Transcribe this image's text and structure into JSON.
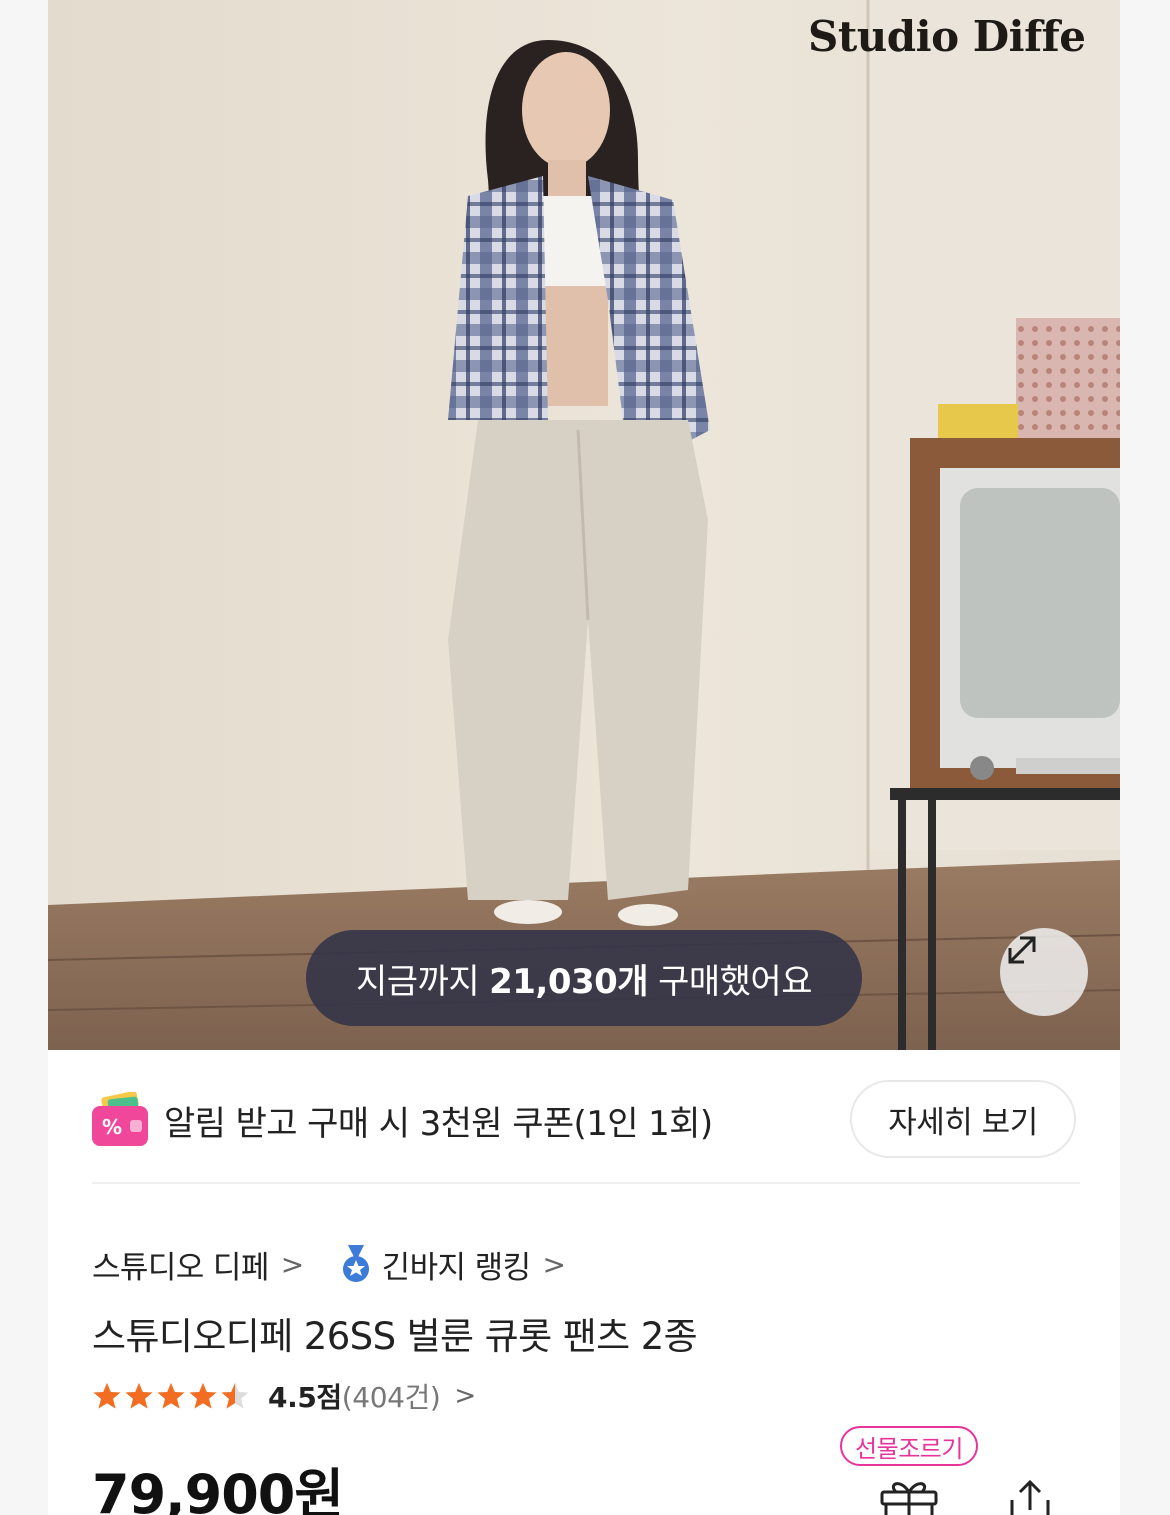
{
  "hero": {
    "brand_logo": "Studio Diffe",
    "purchase_prefix": "지금까지",
    "purchase_count": "21,030개",
    "purchase_suffix": "구매했어요",
    "expand_icon": "expand-icon"
  },
  "coupon": {
    "icon": "coupon-wallet-icon",
    "text": "알림 받고 구매 시 3천원 쿠폰(1인 1회)",
    "detail_button": "자세히 보기"
  },
  "breadcrumb": {
    "brand": "스튜디오 디페",
    "ranking": "긴바지 랭킹",
    "chevron": ">"
  },
  "product": {
    "title": "스튜디오디페 26SS 벌룬 큐롯 팬츠 2종",
    "rating_value": 4.5,
    "rating_score": "4.5점",
    "rating_count": "(404건)",
    "price": "79,900원"
  },
  "actions": {
    "gift_badge": "선물조르기",
    "gift_icon": "gift-icon",
    "share_icon": "share-icon"
  },
  "colors": {
    "accent_pink": "#e8339d",
    "star_orange": "#f26d21",
    "pill_bg": "#343448"
  }
}
